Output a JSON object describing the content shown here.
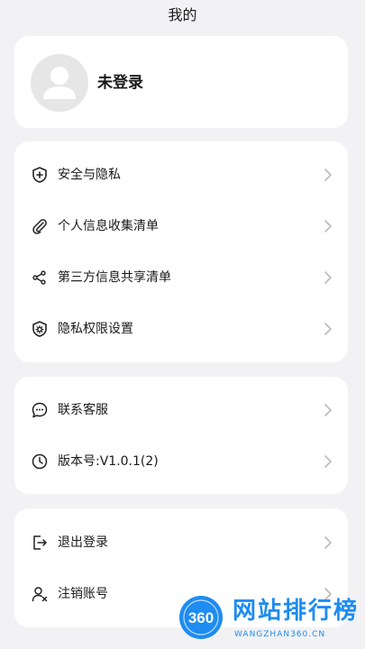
{
  "header": {
    "title": "我的"
  },
  "profile": {
    "name": "未登录"
  },
  "menu_group_1": [
    {
      "label": "安全与隐私",
      "icon": "shield-plus-icon"
    },
    {
      "label": "个人信息收集清单",
      "icon": "paperclip-icon"
    },
    {
      "label": "第三方信息共享清单",
      "icon": "share-icon"
    },
    {
      "label": "隐私权限设置",
      "icon": "shield-gear-icon"
    }
  ],
  "menu_group_2": [
    {
      "label": "联系客服",
      "icon": "chat-bubble-icon"
    },
    {
      "label": "版本号:V1.0.1(2)",
      "icon": "clock-icon"
    }
  ],
  "menu_group_3": [
    {
      "label": "退出登录",
      "icon": "logout-icon"
    },
    {
      "label": "注销账号",
      "icon": "user-remove-icon"
    }
  ],
  "watermark": {
    "logo_text": "360",
    "text": "网站排行榜",
    "sub": "WANGZHAN360.CN"
  },
  "colors": {
    "background": "#f2f2f4",
    "card": "#ffffff",
    "watermark": "#1e8cf0"
  }
}
